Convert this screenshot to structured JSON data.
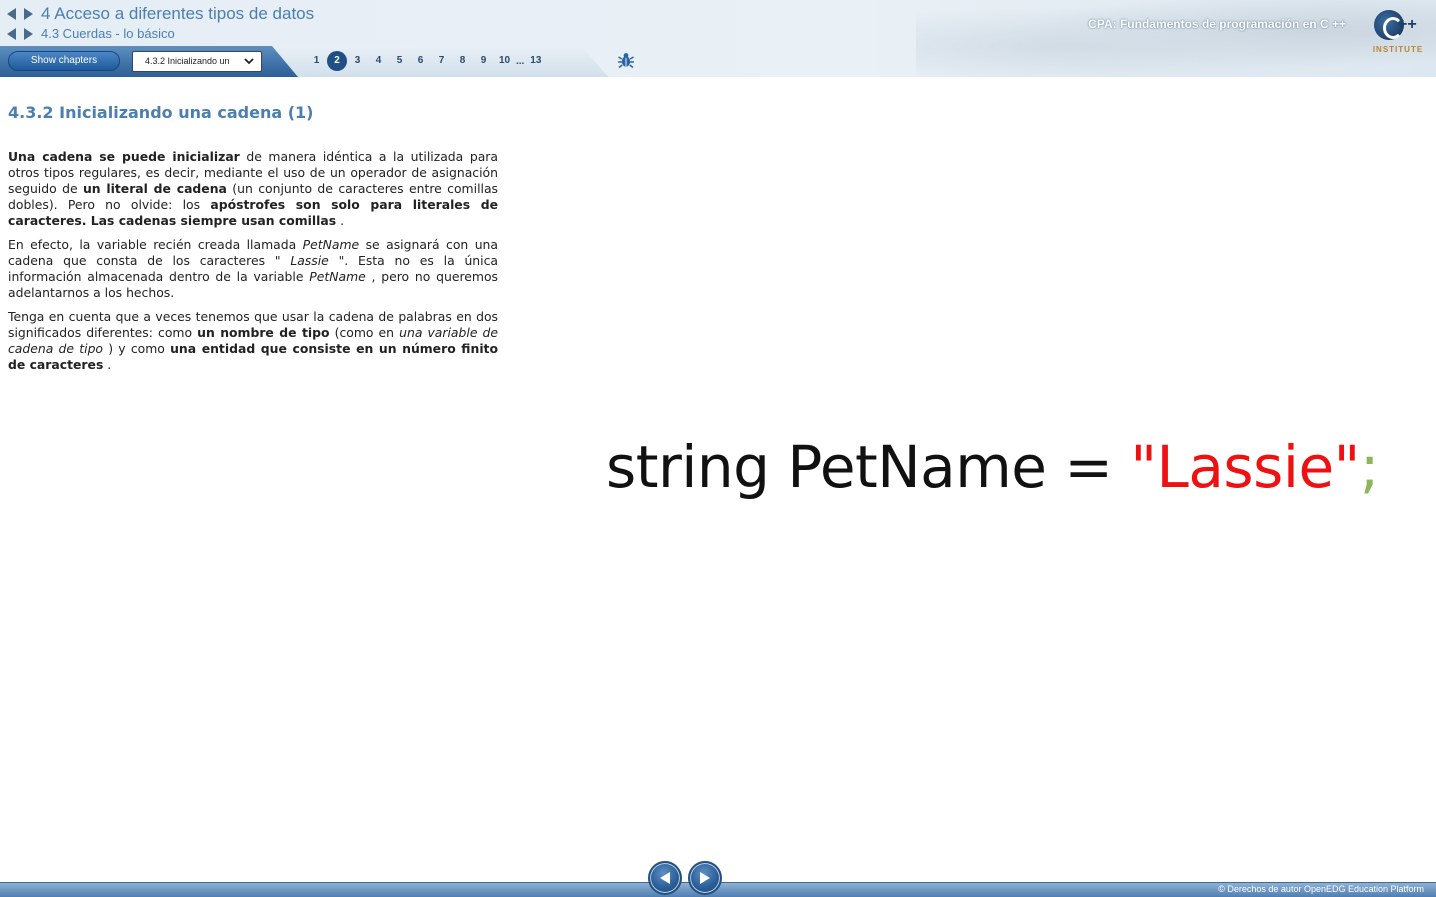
{
  "header": {
    "chapter_title": "4 Acceso a diferentes tipos de datos",
    "section_title": "4.3 Cuerdas - lo básico",
    "course_title": "CPA: Fundamentos de programación en C ++",
    "logo_text": "INSTITUTE",
    "logo_plus": "++"
  },
  "toolbar": {
    "show_chapters_label": "Show chapters",
    "section_select_value": "4.3.2 Inicializando un",
    "pages": [
      "1",
      "2",
      "3",
      "4",
      "5",
      "6",
      "7",
      "8",
      "9",
      "10"
    ],
    "current_page": "2",
    "ellipsis": "...",
    "last_page": "13",
    "bug_icon": "bug-icon"
  },
  "content": {
    "heading": "4.3.2 Inicializando una cadena (1)",
    "p1": {
      "a": "Una cadena se puede inicializar",
      "b": " de manera idéntica a la utilizada para otros tipos regulares, es decir, mediante el uso de un operador de asignación seguido de ",
      "c": "un literal de cadena",
      "d": " (un conjunto de caracteres entre comillas dobles). Pero no olvide: los ",
      "e": "apóstrofes son solo para literales de caracteres. Las cadenas siempre usan comillas",
      "f": " ."
    },
    "p2": {
      "a": "En efecto, la variable recién creada llamada ",
      "b": "PetName",
      "c": " se asignará con una cadena que consta de los caracteres \" ",
      "d": "Lassie",
      "e": " \". Esta no es la única información almacenada dentro de la variable ",
      "f": "PetName",
      "g": " , pero no queremos adelantarnos a los hechos."
    },
    "p3": {
      "a": "Tenga en cuenta que a veces tenemos que usar la cadena de palabras en dos significados diferentes: como ",
      "b": "un nombre de tipo",
      "c": " (como en ",
      "d": "una variable de cadena de tipo",
      "e": " ) y como ",
      "f": "una entidad que consiste en un número finito de caracteres",
      "g": " ."
    },
    "code": {
      "plain": "string PetName = ",
      "string_literal": "\"Lassie\"",
      "semicolon": ";"
    }
  },
  "footer": {
    "copyright": "© Derechos de autor OpenEDG Education Platform",
    "prev_icon": "◄",
    "next_icon": "►"
  },
  "colors": {
    "accent_blue": "#4a7fb0",
    "code_string": "#ee1111",
    "code_semicolon": "#8db55a"
  }
}
